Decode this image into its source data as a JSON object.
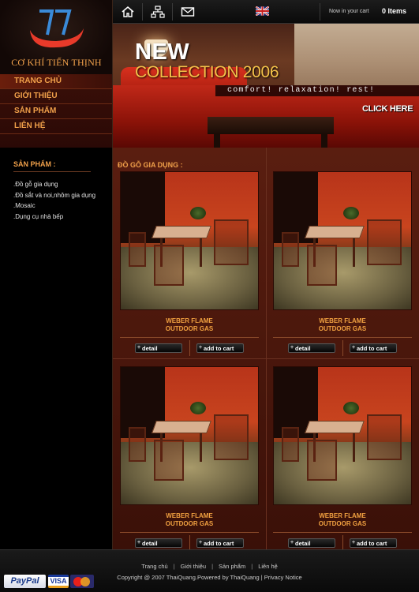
{
  "brand": {
    "name": "CƠ KHÍ TIẾN THỊNH",
    "colors": {
      "accent": "#f0a04a",
      "background": "#1a0d08",
      "logo_blue": "#3a8ad8",
      "logo_red": "#e83a2a"
    }
  },
  "topbar": {
    "icons": [
      "home-icon",
      "sitemap-icon",
      "mail-icon",
      "uk-flag-icon"
    ],
    "cart_text": "Now in your cart",
    "cart_count": "0 Items"
  },
  "nav": {
    "items": [
      {
        "label": "TRANG CHỦ"
      },
      {
        "label": "GIỚI THIỆU"
      },
      {
        "label": "SẢN PHẨM"
      },
      {
        "label": "LIÊN HỆ"
      }
    ]
  },
  "banner": {
    "headline": "NEW",
    "subheadline": "COLLECTION 2006",
    "tagline": "comfort!  relaxation!  rest!",
    "cta": "CLICK HERE"
  },
  "sidebar": {
    "title": "SẢN PHẨM :",
    "items": [
      ".Đồ gỗ gia dụng",
      ".Đồ sắt và noi,nhôm gia dụng",
      ".Mosaic",
      ".Dụng cụ nhà bếp"
    ]
  },
  "content": {
    "title": "ĐỒ GỖ GIA DỤNG :",
    "products": [
      {
        "name_line1": "WEBER FLAME",
        "name_line2": "OUTDOOR GAS",
        "detail_label": "detail",
        "cart_label": "add to cart"
      },
      {
        "name_line1": "WEBER FLAME",
        "name_line2": "OUTDOOR GAS",
        "detail_label": "detail",
        "cart_label": "add to cart"
      },
      {
        "name_line1": "WEBER FLAME",
        "name_line2": "OUTDOOR GAS",
        "detail_label": "detail",
        "cart_label": "add to cart"
      },
      {
        "name_line1": "WEBER FLAME",
        "name_line2": "OUTDOOR GAS",
        "detail_label": "detail",
        "cart_label": "add to cart"
      }
    ]
  },
  "footer": {
    "links": [
      "Trang chủ",
      "Giới thiệu",
      "Sản phẩm",
      "Liên hệ"
    ],
    "copyright": "Copyright @ 2007 ThaiQuang.Powered by ThaiQuang  |  Privacy Notice",
    "payments": {
      "paypal": "PayPal",
      "visa": "VISA",
      "mastercard": "MasterCard"
    }
  }
}
